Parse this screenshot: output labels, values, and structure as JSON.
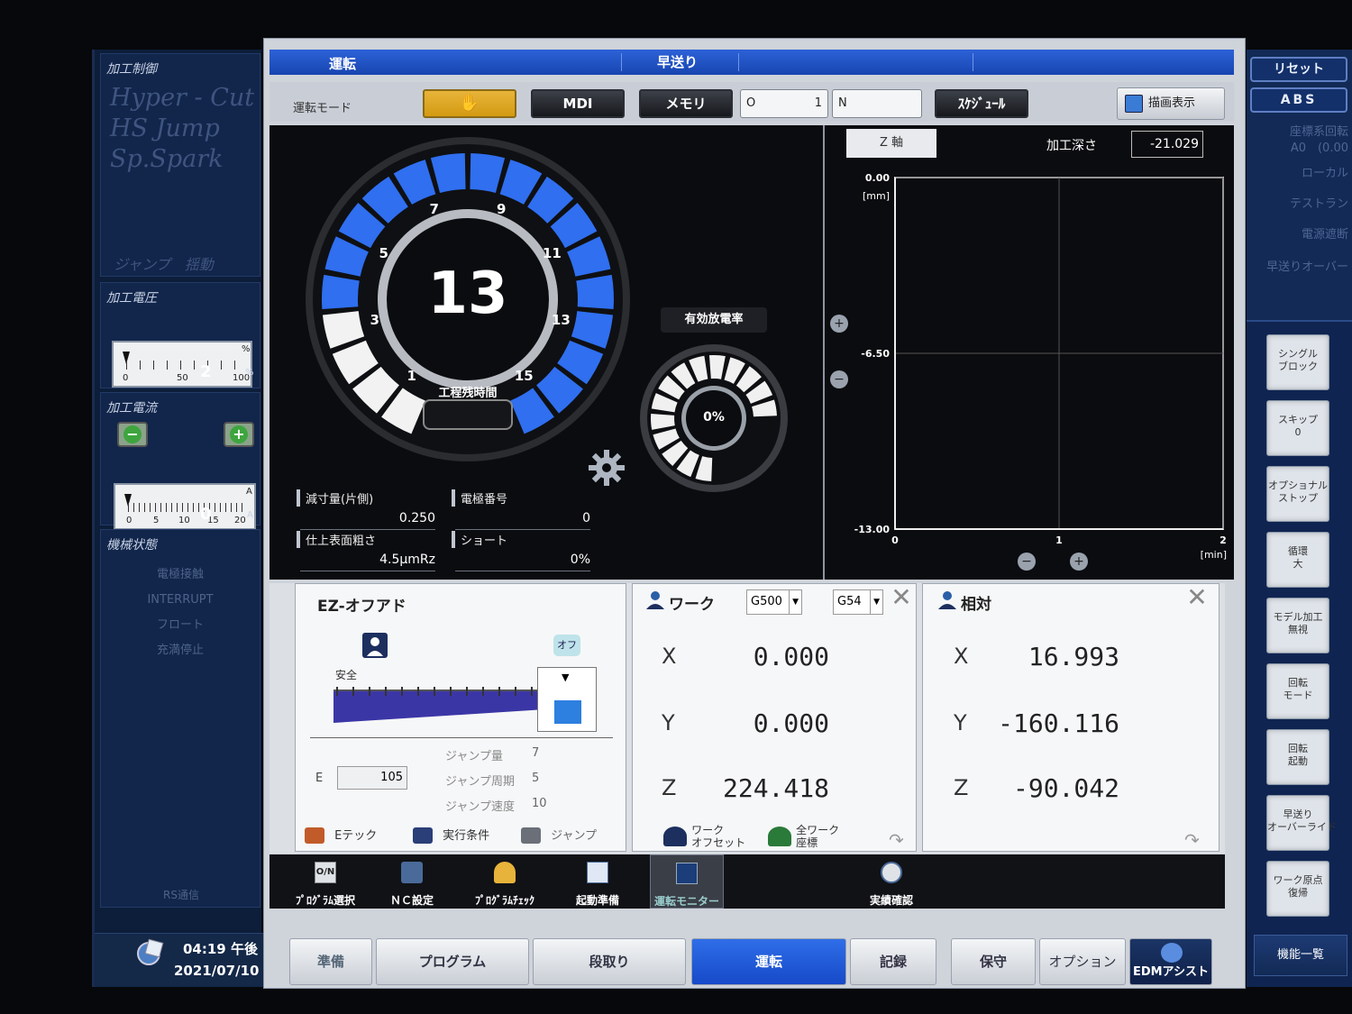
{
  "left": {
    "control_title": "加工制御",
    "ghost_lines": [
      "Hyper - Cut",
      "HS Jump",
      "Sp.Spark"
    ],
    "ghost_jump": "ジャンプ　揺動",
    "voltage": {
      "title": "加工電圧",
      "ticks": [
        "0",
        "50",
        "100"
      ],
      "pct_sign": "%",
      "value": "2",
      "unit": "%"
    },
    "current": {
      "title": "加工電流",
      "ticks": [
        "0",
        "5",
        "10",
        "15",
        "20"
      ],
      "unit_top": "A",
      "value": "0",
      "unit": "A"
    },
    "machine": {
      "title": "機械状態",
      "items": [
        "電極接触",
        "INTERRUPT",
        "フロート",
        "充満停止"
      ]
    },
    "rs": "RS通信",
    "clock": {
      "time": "04:19 午後",
      "date": "2021/07/10"
    }
  },
  "right": {
    "reset": "リセット",
    "abs": "ABS",
    "ghost": [
      "座標系回転",
      "A0　(0.00",
      "ローカル",
      "テストラン",
      "電源遮断",
      "早送りオーバー"
    ],
    "side_buttons": [
      "シングル\nブロック",
      "スキップ\n0",
      "オプショナル\nストップ",
      "循環\n大",
      "モデル加工\n無視",
      "回転\nモード",
      "回転\n起動",
      "早送り\nオーバーライド",
      "ワーク原点\n復帰"
    ],
    "menu": "機能一覧"
  },
  "titlebar": {
    "left": "運転",
    "center": "早送り"
  },
  "modebar": {
    "label": "運転モード",
    "mdi": "MDI",
    "memory": "メモリ",
    "o_label": "O",
    "o_value": "1",
    "n_label": "N",
    "schedule": "ｽｹｼﾞｭｰﾙ",
    "draw": "描画表示"
  },
  "dial": {
    "value": "13",
    "numbers": [
      "1",
      "3",
      "5",
      "7",
      "9",
      "11",
      "13",
      "15"
    ],
    "label": "工程残時間",
    "fill_fraction": 0.8
  },
  "discharge": {
    "title": "有効放電率",
    "value": "0%"
  },
  "info": {
    "reduction_label": "減寸量(片側)",
    "reduction_value": "0.250",
    "electrode_label": "電極番号",
    "electrode_value": "0",
    "finish_label": "仕上表面粗さ",
    "finish_value": "4.5μmRz",
    "short_label": "ショート",
    "short_value": "0%"
  },
  "chart_panel": {
    "axis_tab": "Z 軸",
    "depth_label": "加工深さ",
    "depth_value": "-21.029"
  },
  "chart_data": {
    "type": "line",
    "title": "",
    "xlabel": "[min]",
    "ylabel": "[mm]",
    "xlim": [
      0,
      2
    ],
    "ylim": [
      -13.0,
      0.0
    ],
    "x_ticks": [
      "0",
      "1",
      "2"
    ],
    "y_ticks": [
      "0.00",
      "-6.50",
      "-13.00"
    ],
    "grid": true,
    "series": []
  },
  "ez": {
    "title": "EZ-オフアド",
    "off": "オフ",
    "safe": "安全",
    "e_label": "E",
    "e_value": "105",
    "jump_amount_label": "ジャンプ量",
    "jump_amount": "7",
    "jump_cycle_label": "ジャンプ周期",
    "jump_cycle": "5",
    "jump_speed_label": "ジャンプ速度",
    "jump_speed": "10",
    "tabs": [
      "Eテック",
      "実行条件",
      "ジャンプ"
    ]
  },
  "work": {
    "title": "ワーク",
    "sel1": "G500",
    "sel2": "G54",
    "x": "0.000",
    "y": "0.000",
    "z": "224.418",
    "tab1": "ワーク\nオフセット",
    "tab2": "全ワーク\n座標"
  },
  "relative": {
    "title": "相対",
    "x": "16.993",
    "y": "-160.116",
    "z": "-90.042"
  },
  "axes": [
    "X",
    "Y",
    "Z"
  ],
  "fnbar": [
    "ﾌﾟﾛｸﾞﾗﾑ選択",
    "ＮＣ設定",
    "ﾌﾟﾛｸﾞﾗﾑﾁｪｯｸ",
    "起動準備",
    "運転モニター",
    "実績確認"
  ],
  "nav": [
    "準備",
    "プログラム",
    "段取り",
    "運転",
    "記録",
    "保守",
    "オプション",
    "EDMアシスト"
  ]
}
